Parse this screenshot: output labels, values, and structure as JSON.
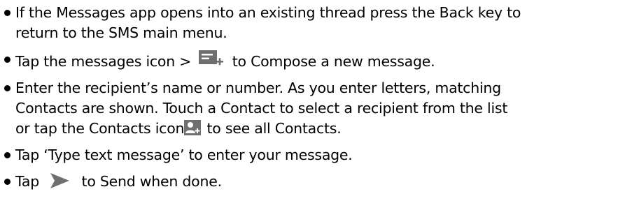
{
  "steps": [
    {
      "lines": [
        "If the Messages app opens into an existing thread press the Back key to",
        "return to the SMS main menu."
      ]
    },
    {
      "before_icon": "Tap the messages icon >",
      "icon": "compose-message-icon",
      "after_icon": "to Compose a new message."
    },
    {
      "lines": [
        "Enter the recipient’s name or number. As you enter letters, matching",
        "Contacts are shown. Touch a Contact to select a recipient from the list"
      ],
      "last_line_before_icon": "or tap the Contacts icon",
      "icon": "add-contact-icon",
      "last_line_after_icon": "to see all Contacts."
    },
    {
      "lines": [
        "Tap ‘Type text message’ to enter your message."
      ]
    },
    {
      "before_icon": "Tap",
      "icon": "send-arrow-icon",
      "after_icon": "to Send when done."
    }
  ],
  "colors": {
    "icon_fill": "#6f6f6f",
    "icon_light": "#ffffff"
  }
}
